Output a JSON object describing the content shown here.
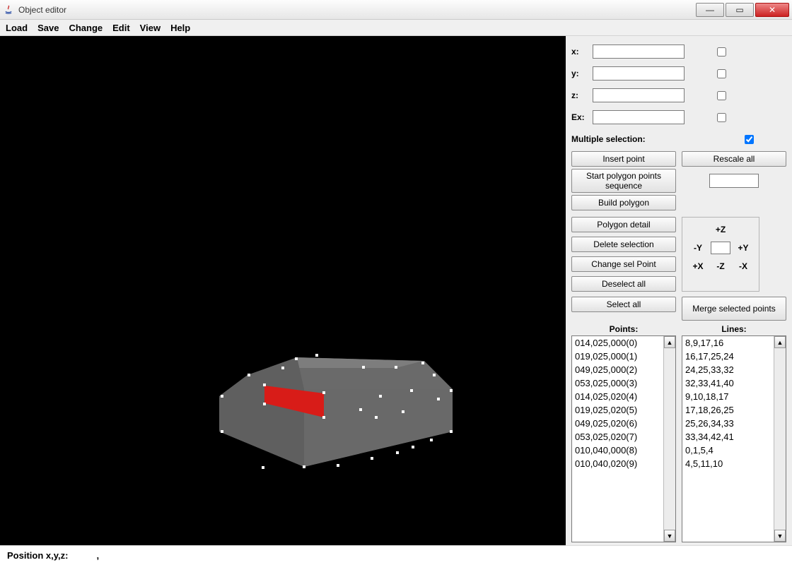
{
  "window": {
    "title": "Object editor"
  },
  "menu": {
    "load": "Load",
    "save": "Save",
    "change": "Change",
    "edit": "Edit",
    "view": "View",
    "help": "Help"
  },
  "coords": {
    "x_label": "x:",
    "x_value": "",
    "y_label": "y:",
    "y_value": "",
    "z_label": "z:",
    "z_value": "",
    "ex_label": "Ex:",
    "ex_value": "",
    "multisel_label": "Multiple selection:",
    "multisel_checked": true
  },
  "buttons": {
    "insert_point": "Insert point",
    "rescale_all": "Rescale all",
    "start_polygon": "Start polygon points sequence",
    "build_polygon": "Build polygon",
    "polygon_detail": "Polygon detail",
    "delete_selection": "Delete selection",
    "change_sel_point": "Change sel Point",
    "deselect_all": "Deselect all",
    "select_all": "Select all",
    "merge_points": "Merge selected points"
  },
  "nav": {
    "pz": "+Z",
    "my": "-Y",
    "py": "+Y",
    "px": "+X",
    "mz": "-Z",
    "mx": "-X",
    "val": ""
  },
  "lists": {
    "points_label": "Points:",
    "lines_label": "Lines:",
    "points": [
      "014,025,000(0)",
      "019,025,000(1)",
      "049,025,000(2)",
      "053,025,000(3)",
      "014,025,020(4)",
      "019,025,020(5)",
      "049,025,020(6)",
      "053,025,020(7)",
      "010,040,000(8)",
      "010,040,020(9)"
    ],
    "lines": [
      "8,9,17,16",
      "16,17,25,24",
      "24,25,33,32",
      "32,33,41,40",
      "9,10,18,17",
      "17,18,26,25",
      "25,26,34,33",
      "33,34,42,41",
      "0,1,5,4",
      "4,5,11,10"
    ]
  },
  "status": {
    "label": "Position x,y,z:",
    "value": ","
  },
  "colors": {
    "panel": "#eeeeee",
    "accent_red": "#d81c18",
    "car_grey": "#6f6f6f"
  }
}
